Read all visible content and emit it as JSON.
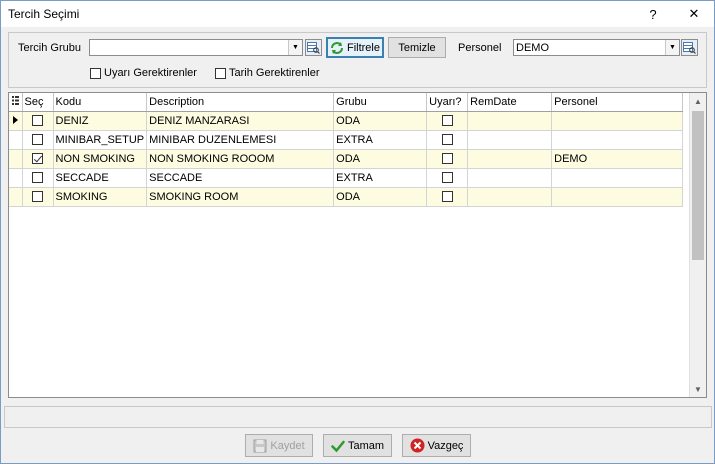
{
  "window": {
    "title": "Tercih Seçimi",
    "help_label": "?",
    "close_label": "✕"
  },
  "filter": {
    "tercih_grubu_label": "Tercih Grubu",
    "tercih_grubu_value": "",
    "filtrele_label": "Filtrele",
    "temizle_label": "Temizle",
    "personel_label": "Personel",
    "personel_value": "DEMO",
    "uyari_label": "Uyarı Gerektirenler",
    "uyari_checked": false,
    "tarih_label": "Tarih Gerektirenler",
    "tarih_checked": false
  },
  "grid": {
    "columns": [
      "Seç",
      "Kodu",
      "Description",
      "Grubu",
      "Uyarı?",
      "RemDate",
      "Personel"
    ],
    "rows": [
      {
        "sec": false,
        "kodu": "DENIZ",
        "description": "DENIZ MANZARASI",
        "grubu": "ODA",
        "uyari": false,
        "remdate": "",
        "personel": "",
        "current": true
      },
      {
        "sec": false,
        "kodu": "MINIBAR_SETUP",
        "description": "MINIBAR DUZENLEMESI",
        "grubu": "EXTRA",
        "uyari": false,
        "remdate": "",
        "personel": "",
        "current": false
      },
      {
        "sec": true,
        "kodu": "NON SMOKING",
        "description": "NON SMOKING ROOOM",
        "grubu": "ODA",
        "uyari": false,
        "remdate": "",
        "personel": "DEMO",
        "current": false
      },
      {
        "sec": false,
        "kodu": "SECCADE",
        "description": "SECCADE",
        "grubu": "EXTRA",
        "uyari": false,
        "remdate": "",
        "personel": "",
        "current": false
      },
      {
        "sec": false,
        "kodu": "SMOKING",
        "description": "SMOKING ROOM",
        "grubu": "ODA",
        "uyari": false,
        "remdate": "",
        "personel": "",
        "current": false
      }
    ]
  },
  "footer": {
    "kaydet_label": "Kaydet",
    "tamam_label": "Tamam",
    "vazgec_label": "Vazgeç"
  },
  "colors": {
    "alt_row": "#fdfbe0",
    "focus_border": "#3c7fb1",
    "ok_green": "#2e9a2e",
    "cancel_red": "#d32020"
  }
}
